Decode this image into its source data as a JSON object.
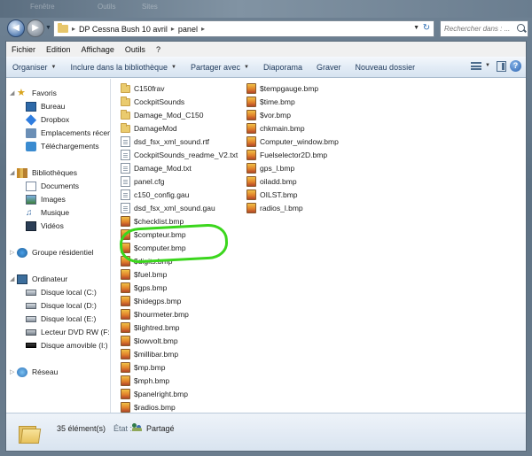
{
  "title_ghost": [
    "Fenêtre",
    "Outils",
    "Sites"
  ],
  "address": {
    "crumbs": [
      "DP Cessna Bush 10 avril",
      "panel"
    ],
    "search_placeholder": "Rechercher dans : ..."
  },
  "menu": [
    "Fichier",
    "Edition",
    "Affichage",
    "Outils",
    "?"
  ],
  "commands": [
    {
      "label": "Organiser",
      "dropdown": true
    },
    {
      "label": "Inclure dans la bibliothèque",
      "dropdown": true
    },
    {
      "label": "Partager avec",
      "dropdown": true
    },
    {
      "label": "Diaporama",
      "dropdown": false
    },
    {
      "label": "Graver",
      "dropdown": false
    },
    {
      "label": "Nouveau dossier",
      "dropdown": false
    }
  ],
  "nav": {
    "favorites": {
      "label": "Favoris",
      "items": [
        "Bureau",
        "Dropbox",
        "Emplacements récents",
        "Téléchargements"
      ]
    },
    "libraries": {
      "label": "Bibliothèques",
      "items": [
        "Documents",
        "Images",
        "Musique",
        "Vidéos"
      ]
    },
    "homegroup": "Groupe résidentiel",
    "computer": {
      "label": "Ordinateur",
      "items": [
        "Disque local (C:)",
        "Disque local (D:)",
        "Disque local (E:)",
        "Lecteur DVD RW (F:)",
        "Disque amovible (I:)"
      ]
    },
    "network": "Réseau"
  },
  "files": {
    "column1": [
      {
        "name": "C150frav",
        "type": "folder"
      },
      {
        "name": "CockpitSounds",
        "type": "folder"
      },
      {
        "name": "Damage_Mod_C150",
        "type": "folder"
      },
      {
        "name": "DamageMod",
        "type": "folder"
      },
      {
        "name": "dsd_fsx_xml_sound.rtf",
        "type": "doc"
      },
      {
        "name": "CockpitSounds_readme_V2.txt",
        "type": "doc"
      },
      {
        "name": "Damage_Mod.txt",
        "type": "doc"
      },
      {
        "name": "panel.cfg",
        "type": "doc"
      },
      {
        "name": "c150_config.gau",
        "type": "doc"
      },
      {
        "name": "dsd_fsx_xml_sound.gau",
        "type": "doc"
      },
      {
        "name": "$checklist.bmp",
        "type": "bmp"
      },
      {
        "name": "$compteur.bmp",
        "type": "bmp"
      },
      {
        "name": "$computer.bmp",
        "type": "bmp"
      },
      {
        "name": "$digits.bmp",
        "type": "bmp"
      },
      {
        "name": "$fuel.bmp",
        "type": "bmp"
      },
      {
        "name": "$gps.bmp",
        "type": "bmp"
      },
      {
        "name": "$hidegps.bmp",
        "type": "bmp"
      },
      {
        "name": "$hourmeter.bmp",
        "type": "bmp"
      },
      {
        "name": "$lightred.bmp",
        "type": "bmp"
      },
      {
        "name": "$lowvolt.bmp",
        "type": "bmp"
      },
      {
        "name": "$millibar.bmp",
        "type": "bmp"
      },
      {
        "name": "$mp.bmp",
        "type": "bmp"
      },
      {
        "name": "$mph.bmp",
        "type": "bmp"
      },
      {
        "name": "$panelright.bmp",
        "type": "bmp"
      },
      {
        "name": "$radios.bmp",
        "type": "bmp"
      }
    ],
    "column2": [
      {
        "name": "$tempgauge.bmp",
        "type": "bmp"
      },
      {
        "name": "$time.bmp",
        "type": "bmp"
      },
      {
        "name": "$vor.bmp",
        "type": "bmp"
      },
      {
        "name": "chkmain.bmp",
        "type": "bmp"
      },
      {
        "name": "Computer_window.bmp",
        "type": "bmp"
      },
      {
        "name": "Fuelselector2D.bmp",
        "type": "bmp"
      },
      {
        "name": "gps_l.bmp",
        "type": "bmp"
      },
      {
        "name": "oiladd.bmp",
        "type": "bmp"
      },
      {
        "name": "OILST.bmp",
        "type": "bmp"
      },
      {
        "name": "radios_l.bmp",
        "type": "bmp"
      }
    ]
  },
  "status": {
    "count": "35 élément(s)",
    "state_label": "État :",
    "state_value": "Partagé"
  },
  "colors": {
    "highlight": "#3bd61d",
    "cmd_text": "#1e395b"
  }
}
